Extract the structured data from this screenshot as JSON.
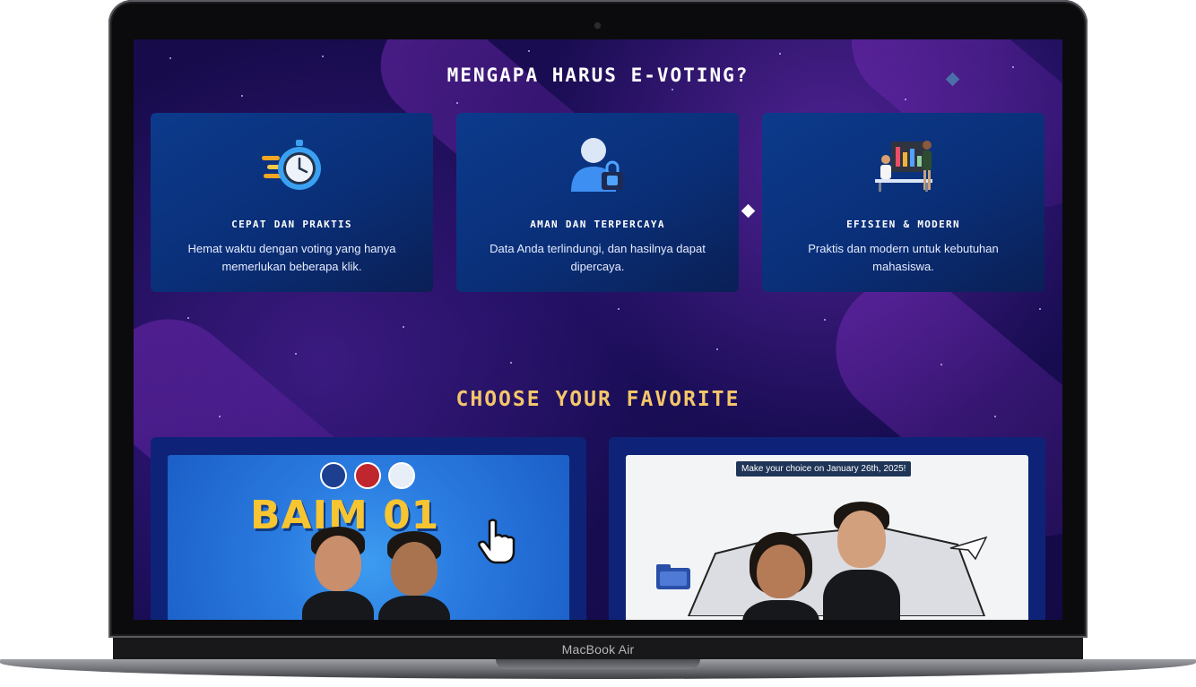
{
  "device": {
    "brand_label": "MacBook Air"
  },
  "why_section": {
    "title": "MENGAPA HARUS E-VOTING?",
    "features": [
      {
        "icon": "stopwatch-icon",
        "title": "CEPAT DAN PRAKTIS",
        "desc": "Hemat waktu dengan voting yang hanya memerlukan beberapa klik."
      },
      {
        "icon": "secure-user-icon",
        "title": "AMAN DAN TERPERCAYA",
        "desc": "Data Anda terlindungi, dan hasilnya dapat dipercaya."
      },
      {
        "icon": "team-dashboard-icon",
        "title": "EFISIEN & MODERN",
        "desc": "Praktis dan modern untuk kebutuhan mahasiswa."
      }
    ]
  },
  "choose_section": {
    "title": "CHOOSE YOUR FAVORITE",
    "candidates": [
      {
        "poster_title": "BAIM 01",
        "accent": "#2a7be0"
      },
      {
        "tagline": "Make your choice on January 26th, 2025!",
        "accent": "#f3f4f6"
      }
    ]
  },
  "colors": {
    "background": "#170b4a",
    "card": "#0c3a8c",
    "title_gold": "#f4c66a",
    "poster_yellow": "#f7c531"
  }
}
